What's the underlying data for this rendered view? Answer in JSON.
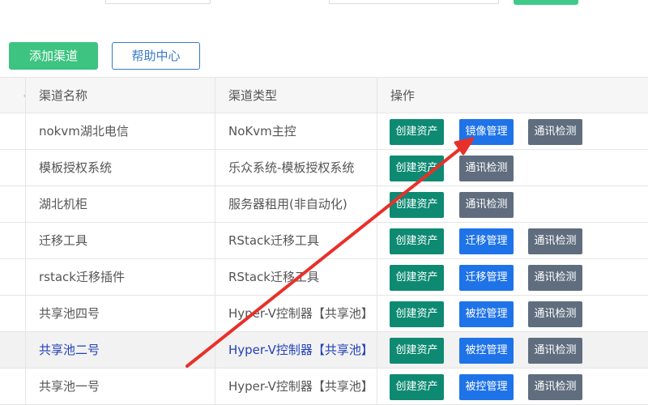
{
  "toolbar": {
    "add_label": "添加渠道",
    "help_label": "帮助中心"
  },
  "table": {
    "headers": [
      "渠道名称",
      "渠道类型",
      "操作"
    ],
    "rows": [
      {
        "name": "nokvm湖北电信",
        "type": "NoKvm主控",
        "ops": [
          {
            "label": "创建资产",
            "color": "green"
          },
          {
            "label": "镜像管理",
            "color": "blue"
          },
          {
            "label": "通讯检测",
            "color": "grey"
          }
        ]
      },
      {
        "name": "模板授权系统",
        "type": "乐众系统-模板授权系统",
        "ops": [
          {
            "label": "创建资产",
            "color": "green"
          },
          {
            "label": "通讯检测",
            "color": "grey"
          }
        ]
      },
      {
        "name": "湖北机柜",
        "type": "服务器租用(非自动化)",
        "ops": [
          {
            "label": "创建资产",
            "color": "green"
          },
          {
            "label": "通讯检测",
            "color": "grey"
          }
        ]
      },
      {
        "name": "迁移工具",
        "type": "RStack迁移工具",
        "ops": [
          {
            "label": "创建资产",
            "color": "green"
          },
          {
            "label": "迁移管理",
            "color": "blue"
          },
          {
            "label": "通讯检测",
            "color": "grey"
          }
        ]
      },
      {
        "name": "rstack迁移插件",
        "type": "RStack迁移工具",
        "ops": [
          {
            "label": "创建资产",
            "color": "green"
          },
          {
            "label": "迁移管理",
            "color": "blue"
          },
          {
            "label": "通讯检测",
            "color": "grey"
          }
        ]
      },
      {
        "name": "共享池四号",
        "type": "Hyper-V控制器【共享池】",
        "ops": [
          {
            "label": "创建资产",
            "color": "green"
          },
          {
            "label": "被控管理",
            "color": "blue"
          },
          {
            "label": "通讯检测",
            "color": "grey"
          }
        ]
      },
      {
        "name": "共享池二号",
        "type": "Hyper-V控制器【共享池】",
        "highlight": true,
        "ops": [
          {
            "label": "创建资产",
            "color": "green"
          },
          {
            "label": "被控管理",
            "color": "blue"
          },
          {
            "label": "通讯检测",
            "color": "grey"
          }
        ]
      },
      {
        "name": "共享池一号",
        "type": "Hyper-V控制器【共享池】",
        "ops": [
          {
            "label": "创建资产",
            "color": "green"
          },
          {
            "label": "被控管理",
            "color": "blue"
          },
          {
            "label": "通讯检测",
            "color": "grey"
          }
        ]
      }
    ]
  },
  "colors": {
    "annotation_arrow": "#e8302a"
  }
}
